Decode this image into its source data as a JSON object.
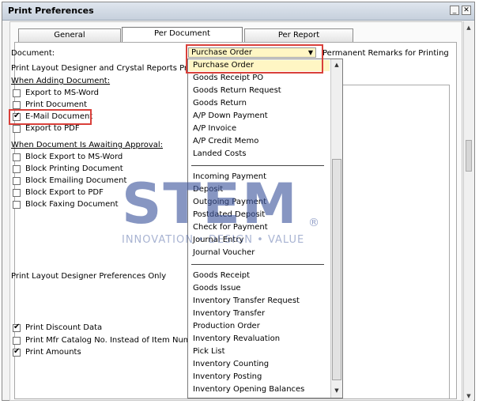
{
  "window": {
    "title": "Print Preferences",
    "minimize_icon": "minimize-icon",
    "close_icon": "close-icon"
  },
  "tabs": [
    {
      "label": "General",
      "active": false
    },
    {
      "label": "Per Document",
      "active": true
    },
    {
      "label": "Per Report",
      "active": false
    }
  ],
  "form": {
    "document_label": "Document:",
    "document_value": "Purchase Order",
    "permanent_remarks_label": "Permanent Remarks for Printing",
    "designer_prefs_label": "Print Layout Designer and Crystal Reports Prefere",
    "when_adding_label": "When Adding Document:",
    "adding_options": [
      {
        "label": "Export to MS-Word",
        "checked": false
      },
      {
        "label": "Print Document",
        "checked": false
      },
      {
        "label": "E-Mail Document",
        "checked": true
      },
      {
        "label": "Export to PDF",
        "checked": false
      }
    ],
    "awaiting_label": "When Document Is Awaiting Approval:",
    "awaiting_options": [
      {
        "label": "Block Export to MS-Word",
        "checked": false
      },
      {
        "label": "Block Printing Document",
        "checked": false
      },
      {
        "label": "Block Emailing Document",
        "checked": false
      },
      {
        "label": "Block Export to PDF",
        "checked": false
      },
      {
        "label": "Block Faxing Document",
        "checked": false
      }
    ],
    "pld_only_label": "Print Layout Designer Preferences Only",
    "pld_options": [
      {
        "label": "Print Discount Data",
        "checked": true
      },
      {
        "label": "Print Mfr Catalog No. Instead of Item Number",
        "checked": false
      },
      {
        "label": "Print Amounts",
        "checked": true
      }
    ]
  },
  "dropdown": {
    "group1": [
      "Purchase Order",
      "Goods Receipt PO",
      "Goods Return Request",
      "Goods Return",
      "A/P Down Payment",
      "A/P Invoice",
      "A/P Credit Memo",
      "Landed Costs"
    ],
    "group2": [
      "Incoming Payment",
      "Deposit",
      "Outgoing Payment",
      "Postdated Deposit",
      "Check for Payment",
      "Journal Entry",
      "Journal Voucher"
    ],
    "group3": [
      "Goods Receipt",
      "Goods Issue",
      "Inventory Transfer Request",
      "Inventory Transfer",
      "Production Order",
      "Inventory Revaluation",
      "Pick List",
      "Inventory Counting",
      "Inventory Posting",
      "Inventory Opening Balances"
    ],
    "highlight_color": "#fff6c4",
    "scroll_up_icon": "scroll-up-icon",
    "scroll_down_icon": "scroll-down-icon"
  },
  "watermark": {
    "big": "STEM",
    "small": "INNOVATION • DESIGN • VALUE",
    "reg": "®"
  },
  "colors": {
    "callout_red": "#d9403a",
    "combo_yellow": "#fff6c4"
  }
}
